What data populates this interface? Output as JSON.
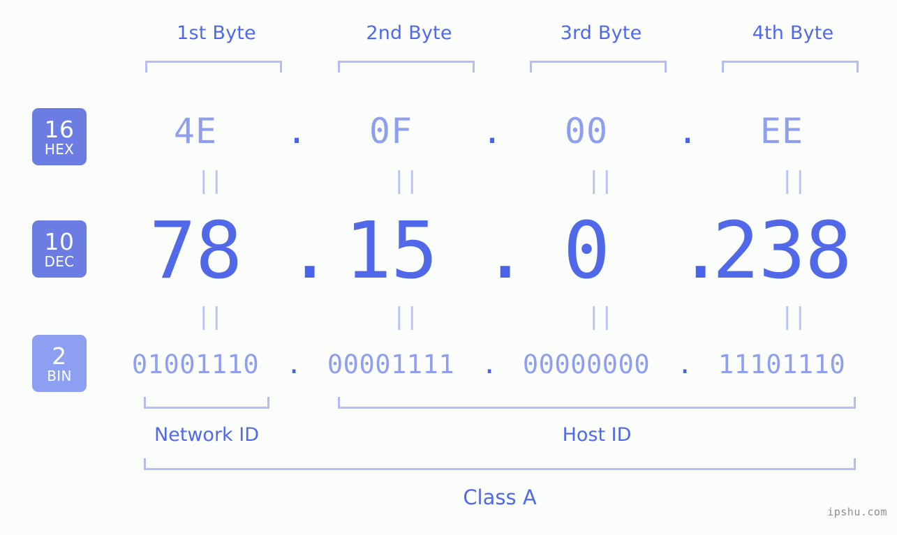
{
  "meta": {
    "background_color": "#fbfdfa",
    "accent_color": "#5169e8",
    "light_accent_color": "#8f9eef",
    "bracket_color": "#b3bdf4",
    "badge_color": "#6b7ce2",
    "badge_light_color": "#8c9ff0",
    "watermark": "ipshu.com"
  },
  "byte_headers": [
    {
      "label": "1st Byte"
    },
    {
      "label": "2nd Byte"
    },
    {
      "label": "3rd Byte"
    },
    {
      "label": "4th Byte"
    }
  ],
  "bases": [
    {
      "number": "16",
      "name": "HEX"
    },
    {
      "number": "10",
      "name": "DEC"
    },
    {
      "number": "2",
      "name": "BIN"
    }
  ],
  "rows": {
    "hex": {
      "base_number": "16",
      "base_name": "HEX",
      "values": [
        "4E",
        "0F",
        "00",
        "EE"
      ],
      "separator": "."
    },
    "dec": {
      "base_number": "10",
      "base_name": "DEC",
      "values": [
        "78",
        "15",
        "0",
        "238"
      ],
      "separator": "."
    },
    "bin": {
      "base_number": "2",
      "base_name": "BIN",
      "values": [
        "01001110",
        "00001111",
        "00000000",
        "11101110"
      ],
      "separator": "."
    }
  },
  "equals_marks": {
    "glyph": "||"
  },
  "segments": [
    {
      "label": "Network ID"
    },
    {
      "label": "Host ID"
    }
  ],
  "class": {
    "label": "Class A"
  },
  "address": {
    "dec": "78.15.0.238",
    "hex": "4E.0F.00.EE",
    "bin": "01001110.00001111.00000000.11101110"
  }
}
